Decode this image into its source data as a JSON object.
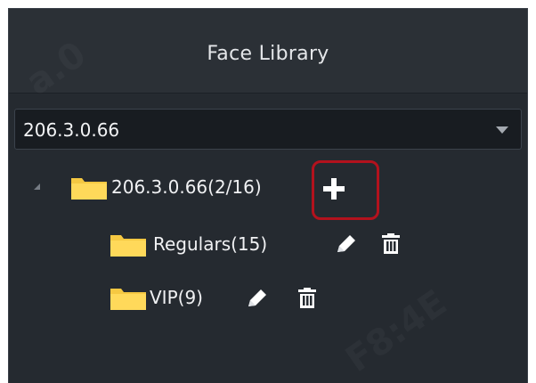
{
  "panel": {
    "title": "Face Library"
  },
  "device_select": {
    "selected": "206.3.0.66"
  },
  "tree": {
    "root": {
      "label": "206.3.0.66(2/16)"
    },
    "children": [
      {
        "label": "Regulars(15)"
      },
      {
        "label": "VIP(9)"
      }
    ]
  },
  "colors": {
    "panel_bg": "#252a30",
    "folder": "#f5c842",
    "highlight": "#b3121d",
    "text": "#f0f1f3"
  },
  "icons": {
    "add": "plus-icon",
    "edit": "pencil-icon",
    "delete": "trash-icon",
    "folder": "folder-icon",
    "expander": "collapse-triangle-icon",
    "dropdown": "chevron-down-icon"
  }
}
